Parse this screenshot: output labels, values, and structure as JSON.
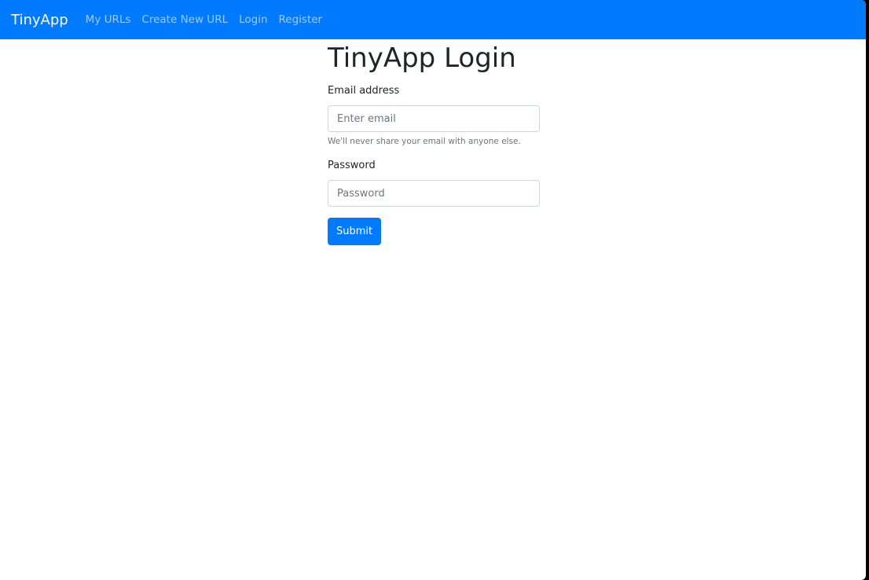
{
  "colors": {
    "primary": "#007bff",
    "text": "#212529",
    "muted": "#6c757d"
  },
  "navbar": {
    "brand": "TinyApp",
    "links": [
      "My URLs",
      "Create New URL",
      "Login",
      "Register"
    ]
  },
  "main": {
    "title": "TinyApp Login",
    "email": {
      "label": "Email address",
      "placeholder": "Enter email",
      "help": "We'll never share your email with anyone else."
    },
    "password": {
      "label": "Password",
      "placeholder": "Password"
    },
    "submit_label": "Submit"
  }
}
